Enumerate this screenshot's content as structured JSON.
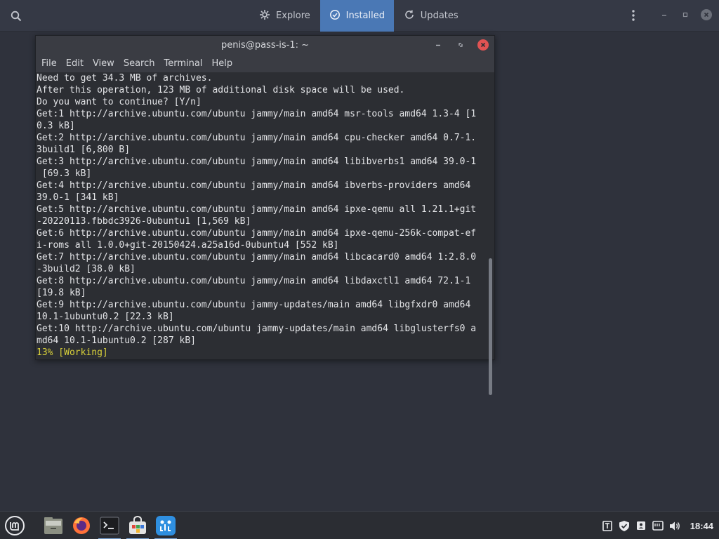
{
  "appbar": {
    "tabs": [
      {
        "label": "Explore",
        "icon": "explore-icon"
      },
      {
        "label": "Installed",
        "icon": "check-circle-icon"
      },
      {
        "label": "Updates",
        "icon": "refresh-icon"
      }
    ],
    "active_tab": "Installed",
    "accent": "#4a78b5"
  },
  "terminal": {
    "title": "penis@pass-is-1: ~",
    "menu": [
      "File",
      "Edit",
      "View",
      "Search",
      "Terminal",
      "Help"
    ],
    "lines": [
      "Need to get 34.3 MB of archives.",
      "After this operation, 123 MB of additional disk space will be used.",
      "Do you want to continue? [Y/n]",
      "Get:1 http://archive.ubuntu.com/ubuntu jammy/main amd64 msr-tools amd64 1.3-4 [1",
      "0.3 kB]",
      "Get:2 http://archive.ubuntu.com/ubuntu jammy/main amd64 cpu-checker amd64 0.7-1.",
      "3build1 [6,800 B]",
      "Get:3 http://archive.ubuntu.com/ubuntu jammy/main amd64 libibverbs1 amd64 39.0-1",
      " [69.3 kB]",
      "Get:4 http://archive.ubuntu.com/ubuntu jammy/main amd64 ibverbs-providers amd64",
      "39.0-1 [341 kB]",
      "Get:5 http://archive.ubuntu.com/ubuntu jammy/main amd64 ipxe-qemu all 1.21.1+git",
      "-20220113.fbbdc3926-0ubuntu1 [1,569 kB]",
      "Get:6 http://archive.ubuntu.com/ubuntu jammy/main amd64 ipxe-qemu-256k-compat-ef",
      "i-roms all 1.0.0+git-20150424.a25a16d-0ubuntu4 [552 kB]",
      "Get:7 http://archive.ubuntu.com/ubuntu jammy/main amd64 libcacard0 amd64 1:2.8.0",
      "-3build2 [38.0 kB]",
      "Get:8 http://archive.ubuntu.com/ubuntu jammy/main amd64 libdaxctl1 amd64 72.1-1",
      "[19.8 kB]",
      "Get:9 http://archive.ubuntu.com/ubuntu jammy-updates/main amd64 libgfxdr0 amd64",
      "10.1-1ubuntu0.2 [22.3 kB]",
      "Get:10 http://archive.ubuntu.com/ubuntu jammy-updates/main amd64 libglusterfs0 a",
      "md64 10.1-1ubuntu0.2 [287 kB]"
    ],
    "status_line": "13% [Working]",
    "status_color": "#d9d13a"
  },
  "taskbar": {
    "apps": [
      "menu-icon",
      "files-icon",
      "firefox-icon",
      "terminal-icon",
      "software-manager-icon",
      "app-icon"
    ],
    "tray": [
      "clipboard-icon",
      "shield-icon",
      "user-icon",
      "network-icon",
      "volume-icon"
    ],
    "clock": "18:44"
  }
}
